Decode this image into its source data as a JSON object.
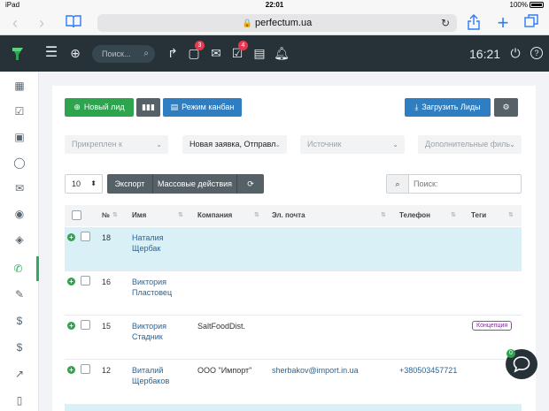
{
  "status_bar": {
    "device": "iPad",
    "time": "22:01",
    "battery": "100%"
  },
  "browser": {
    "url": "perfectum.ua"
  },
  "topbar": {
    "search_placeholder": "Поиск...",
    "badge_tasks": "3",
    "badge_checks": "4",
    "clock": "16:21"
  },
  "toolbar": {
    "new_lead": "Новый лид",
    "kanban": "Режим канбан",
    "upload": "Загрузить Лиды"
  },
  "filters": {
    "assigned": "Прикреплен к",
    "status": "Новая заявка, Отправл",
    "source": "Источник",
    "extra": "Дополнительные филь"
  },
  "table_controls": {
    "page_size": "10",
    "export": "Экспорт",
    "bulk": "Массовые действия",
    "search_placeholder": "Поиск:"
  },
  "table": {
    "columns": [
      "№",
      "Имя",
      "Компания",
      "Эл. почта",
      "Телефон",
      "Теги"
    ],
    "rows": [
      {
        "num": "18",
        "name1": "Наталия",
        "name2": "Щербак",
        "company": "",
        "email": "",
        "phone": "",
        "tag": ""
      },
      {
        "num": "16",
        "name1": "Виктория",
        "name2": "Пластовец",
        "company": "",
        "email": "",
        "phone": "",
        "tag": ""
      },
      {
        "num": "15",
        "name1": "Виктория",
        "name2": "Стадник",
        "company": "SaltFoodDist.",
        "email": "",
        "phone": "",
        "tag": "Концепция"
      },
      {
        "num": "12",
        "name1": "Виталий",
        "name2": "Щербаков",
        "company": "ООО \"Импорт\"",
        "email": "sherbakov@import.in.ua",
        "phone": "+380503457721",
        "tag": ""
      }
    ]
  },
  "chat": {
    "badge": "0"
  },
  "colors": {
    "topbar": "#263238",
    "green": "#2ea44f",
    "blue": "#2f7ec1",
    "row_highlight": "#d9f0f6",
    "tag": "#a93cc4"
  }
}
